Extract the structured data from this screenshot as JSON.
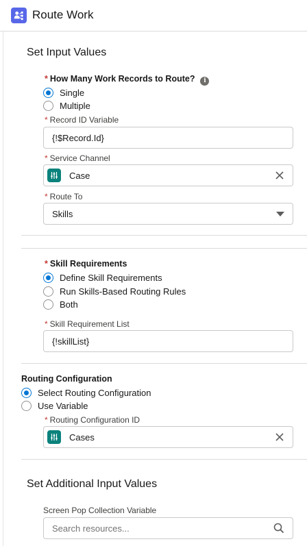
{
  "header": {
    "title": "Route Work"
  },
  "section1": {
    "title": "Set Input Values",
    "work_records": {
      "label": "How Many Work Records to Route?",
      "options": [
        "Single",
        "Multiple"
      ]
    },
    "record_id": {
      "label": "Record ID Variable",
      "value": "{!$Record.Id}"
    },
    "service_channel": {
      "label": "Service Channel",
      "value": "Case"
    },
    "route_to": {
      "label": "Route To",
      "value": "Skills"
    }
  },
  "skills": {
    "label": "Skill Requirements",
    "options": [
      "Define Skill Requirements",
      "Run Skills-Based Routing Rules",
      "Both"
    ],
    "list": {
      "label": "Skill Requirement List",
      "value": "{!skillList}"
    }
  },
  "routing": {
    "label": "Routing Configuration",
    "options": [
      "Select Routing Configuration",
      "Use Variable"
    ],
    "config_id": {
      "label": "Routing Configuration ID",
      "value": "Cases"
    }
  },
  "section2": {
    "title": "Set Additional Input Values",
    "screen_pop": {
      "label": "Screen Pop Collection Variable",
      "placeholder": "Search resources..."
    }
  },
  "colors": {
    "brand": "#5867e8",
    "accent": "#0176d3",
    "channel": "#0b827c",
    "required": "#c23934"
  }
}
